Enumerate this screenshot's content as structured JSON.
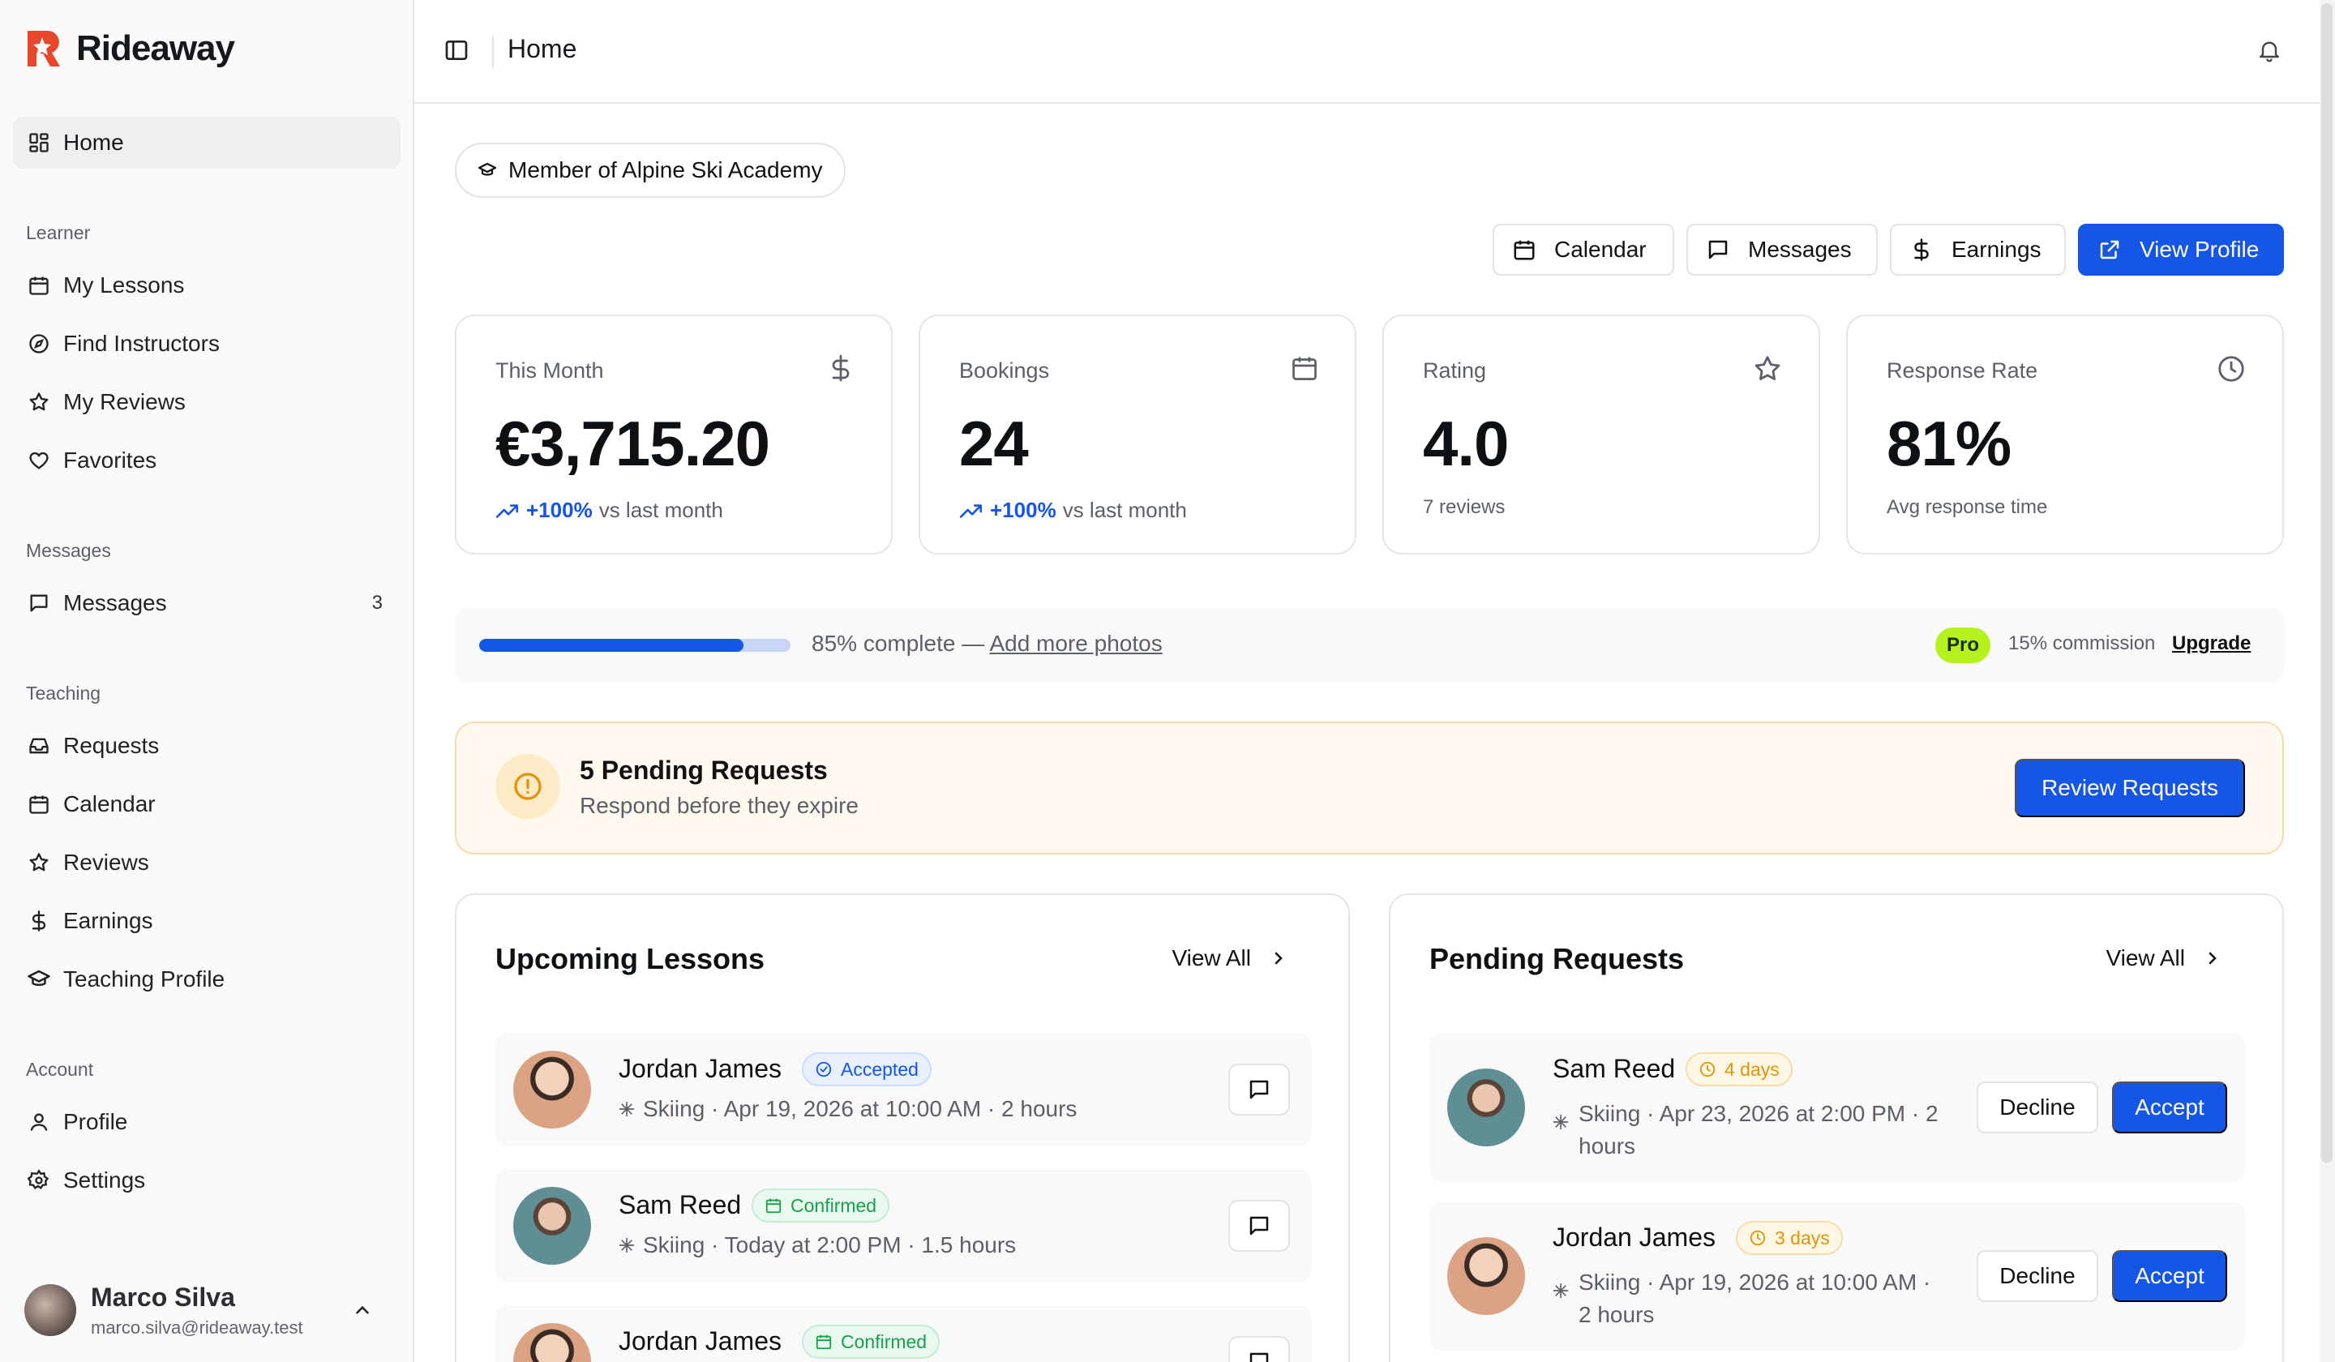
{
  "brand": {
    "name": "Rideaway",
    "accent": "#e8472b"
  },
  "sidebar": {
    "home": {
      "label": "Home",
      "icon": "grid-icon"
    },
    "groups": {
      "learner": {
        "title": "Learner",
        "items": [
          {
            "label": "My Lessons",
            "icon": "calendar-icon"
          },
          {
            "label": "Find Instructors",
            "icon": "compass-icon"
          },
          {
            "label": "My Reviews",
            "icon": "star-icon"
          },
          {
            "label": "Favorites",
            "icon": "heart-icon"
          }
        ]
      },
      "messages": {
        "title": "Messages",
        "items": [
          {
            "label": "Messages",
            "icon": "chat-icon",
            "badge": "3"
          }
        ]
      },
      "teaching": {
        "title": "Teaching",
        "items": [
          {
            "label": "Requests",
            "icon": "inbox-icon"
          },
          {
            "label": "Calendar",
            "icon": "calendar-grid-icon"
          },
          {
            "label": "Reviews",
            "icon": "star-icon"
          },
          {
            "label": "Earnings",
            "icon": "dollar-icon"
          },
          {
            "label": "Teaching Profile",
            "icon": "graduation-cap-icon"
          }
        ]
      },
      "account": {
        "title": "Account",
        "items": [
          {
            "label": "Profile",
            "icon": "user-icon"
          },
          {
            "label": "Settings",
            "icon": "gear-icon"
          }
        ]
      }
    },
    "user": {
      "name": "Marco Silva",
      "email": "marco.silva@rideaway.test"
    }
  },
  "header": {
    "title": "Home"
  },
  "member_badge": "Member of Alpine Ski Academy",
  "actions": {
    "calendar": "Calendar",
    "messages": "Messages",
    "earnings": "Earnings",
    "view_profile": "View Profile"
  },
  "stats": [
    {
      "title": "This Month",
      "value": "€3,715.20",
      "change": "+100%",
      "note": "vs last month",
      "icon": "dollar-icon"
    },
    {
      "title": "Bookings",
      "value": "24",
      "change": "+100%",
      "note": "vs last month",
      "icon": "calendar-icon"
    },
    {
      "title": "Rating",
      "value": "4.0",
      "note": "7 reviews",
      "icon": "star-icon"
    },
    {
      "title": "Response Rate",
      "value": "81%",
      "note": "Avg response time",
      "icon": "clock-icon"
    }
  ],
  "profile_progress": {
    "percent": 85,
    "text": "85% complete — ",
    "link": "Add more photos",
    "plan": "Pro",
    "commission": "15% commission",
    "upgrade": "Upgrade"
  },
  "pending_alert": {
    "title": "5 Pending Requests",
    "subtitle": "Respond before they expire",
    "button": "Review Requests"
  },
  "upcoming": {
    "title": "Upcoming Lessons",
    "view_all": "View All",
    "lessons": [
      {
        "name": "Jordan James",
        "status": "Accepted",
        "meta": "Skiing · Apr 19, 2026 at 10:00 AM · 2 hours"
      },
      {
        "name": "Sam Reed",
        "status": "Confirmed",
        "meta": "Skiing · Today at 2:00 PM · 1.5 hours"
      },
      {
        "name": "Jordan James",
        "status": "Confirmed",
        "meta": ""
      }
    ]
  },
  "pending": {
    "title": "Pending Requests",
    "view_all": "View All",
    "decline": "Decline",
    "accept": "Accept",
    "requests": [
      {
        "name": "Sam Reed",
        "expires": "4 days",
        "meta": "Skiing · Apr 23, 2026 at 2:00 PM · 2 hours"
      },
      {
        "name": "Jordan James",
        "expires": "3 days",
        "meta": "Skiing · Apr 19, 2026 at 10:00 AM · 2 hours"
      }
    ]
  },
  "colors": {
    "primary": "#1556e6",
    "pro_badge": "#b5f21f",
    "warning": "#e29409",
    "success": "#18a04a"
  }
}
